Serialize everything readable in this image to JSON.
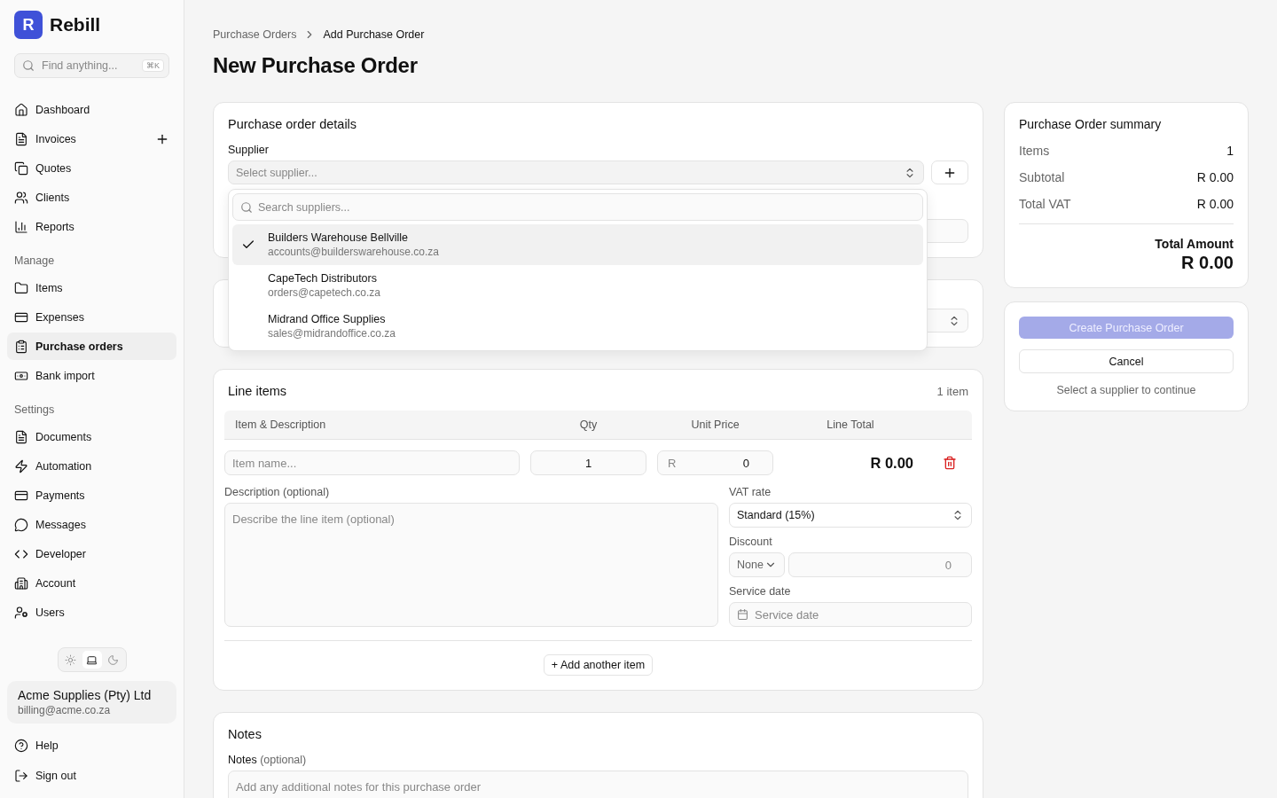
{
  "brand": {
    "initial": "R",
    "name": "Rebill"
  },
  "search": {
    "placeholder": "Find anything...",
    "shortcut": "⌘K"
  },
  "nav_groups": [
    {
      "items": [
        {
          "label": "Dashboard",
          "selected": false
        },
        {
          "label": "Invoices",
          "selected": false,
          "has_add": true
        },
        {
          "label": "Quotes",
          "selected": false
        },
        {
          "label": "Clients",
          "selected": false
        },
        {
          "label": "Reports",
          "selected": false
        }
      ]
    },
    {
      "heading": "Manage",
      "items": [
        {
          "label": "Items",
          "selected": false
        },
        {
          "label": "Expenses",
          "selected": false
        },
        {
          "label": "Purchase orders",
          "selected": true
        },
        {
          "label": "Bank import",
          "selected": false
        }
      ]
    },
    {
      "heading": "Settings",
      "items": [
        {
          "label": "Documents",
          "selected": false
        },
        {
          "label": "Automation",
          "selected": false
        },
        {
          "label": "Payments",
          "selected": false
        },
        {
          "label": "Messages",
          "selected": false
        },
        {
          "label": "Developer",
          "selected": false
        },
        {
          "label": "Account",
          "selected": false
        },
        {
          "label": "Users",
          "selected": false
        }
      ]
    }
  ],
  "theme_toggle": [
    {
      "selected": false
    },
    {
      "selected": true
    },
    {
      "selected": false
    }
  ],
  "account": {
    "name": "Acme Supplies (Pty) Ltd",
    "email": "billing@acme.co.za"
  },
  "footer_links": [
    "Help",
    "Sign out"
  ],
  "breadcrumb": [
    "Purchase Orders",
    "Add Purchase Order"
  ],
  "page_title": "New Purchase Order",
  "details": {
    "title": "Purchase order details",
    "supplier_label": "Supplier",
    "supplier_placeholder": "Select supplier...",
    "dropdown": {
      "search_placeholder": "Search suppliers...",
      "options": [
        {
          "name": "Builders Warehouse Bellville",
          "email": "accounts@builderswarehouse.co.za",
          "selected": true
        },
        {
          "name": "CapeTech Distributors",
          "email": "orders@capetech.co.za",
          "selected": false
        },
        {
          "name": "Midrand Office Supplies",
          "email": "sales@midrandoffice.co.za",
          "selected": false
        }
      ]
    }
  },
  "line_items": {
    "title": "Line items",
    "count": "1 item",
    "columns": [
      "Item & Description",
      "Qty",
      "Unit Price",
      "Line Total"
    ],
    "row": {
      "item_placeholder": "Item name...",
      "qty": "1",
      "currency": "R",
      "unit_price": "0",
      "line_total": "R 0.00",
      "description_label": "Description (optional)",
      "description_placeholder": "Describe the line item (optional)",
      "vat_label": "VAT rate",
      "vat_value": "Standard (15%)",
      "discount_label": "Discount",
      "discount_type": "None",
      "discount_placeholder": "0",
      "service_date_label": "Service date",
      "service_date_placeholder": "Service date"
    },
    "add_button": "+ Add another item"
  },
  "notes": {
    "title": "Notes",
    "label": "Notes",
    "label_hint": "(optional)",
    "placeholder": "Add any additional notes for this purchase order"
  },
  "summary": {
    "title": "Purchase Order summary",
    "rows": [
      {
        "label": "Items",
        "value": "1"
      },
      {
        "label": "Subtotal",
        "value": "R 0.00"
      },
      {
        "label": "Total VAT",
        "value": "R 0.00"
      }
    ],
    "total_label": "Total Amount",
    "total_value": "R 0.00"
  },
  "actions": {
    "create": {
      "label": "Create Purchase Order",
      "disabled": true
    },
    "cancel": "Cancel",
    "hint": "Select a supplier to continue"
  }
}
